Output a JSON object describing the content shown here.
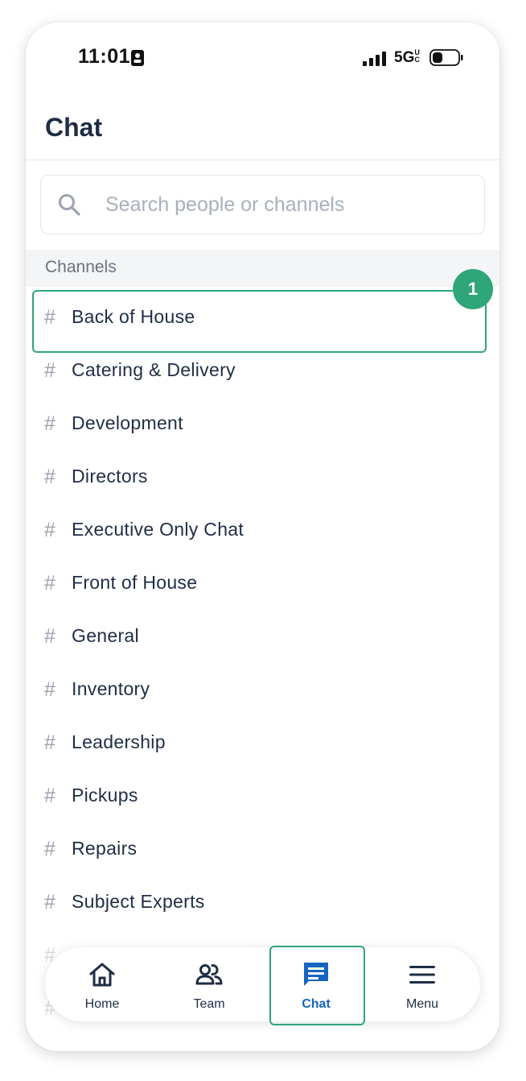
{
  "status_bar": {
    "time": "11:01",
    "network": "5G",
    "network_sub": "UC"
  },
  "header": {
    "title": "Chat"
  },
  "search": {
    "placeholder": "Search people or channels",
    "value": ""
  },
  "channels_section": {
    "label": "Channels",
    "items": [
      {
        "label": "Back of House"
      },
      {
        "label": "Catering & Delivery"
      },
      {
        "label": "Development"
      },
      {
        "label": "Directors"
      },
      {
        "label": "Executive Only Chat"
      },
      {
        "label": "Front of House"
      },
      {
        "label": "General"
      },
      {
        "label": "Inventory"
      },
      {
        "label": "Leadership"
      },
      {
        "label": "Pickups"
      },
      {
        "label": "Repairs"
      },
      {
        "label": "Subject Experts"
      },
      {
        "label": ""
      },
      {
        "label": ""
      }
    ]
  },
  "step_badge": "1",
  "tab_bar": {
    "tabs": [
      {
        "label": "Home",
        "icon": "home-icon"
      },
      {
        "label": "Team",
        "icon": "team-icon"
      },
      {
        "label": "Chat",
        "icon": "chat-icon",
        "active": true
      },
      {
        "label": "Menu",
        "icon": "menu-icon"
      }
    ]
  },
  "colors": {
    "accent": "#1565c0",
    "highlight": "#2fa57a",
    "text": "#1f2d45"
  }
}
